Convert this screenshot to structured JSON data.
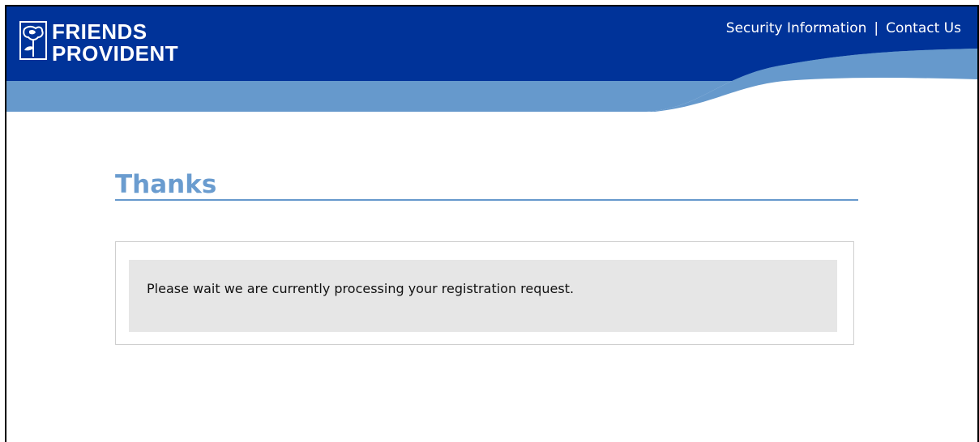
{
  "brand": {
    "name_line1": "FRIENDS",
    "name_line2": "PROVIDENT"
  },
  "header": {
    "links": {
      "security": "Security Information",
      "separator": "|",
      "contact": "Contact Us"
    }
  },
  "main": {
    "title": "Thanks",
    "message": "Please wait we are currently processing your registration request."
  },
  "colors": {
    "header_blue": "#003399",
    "wave_light_blue": "#6699cc",
    "title_blue": "#6a9ccf",
    "panel_grey": "#e6e6e6"
  }
}
